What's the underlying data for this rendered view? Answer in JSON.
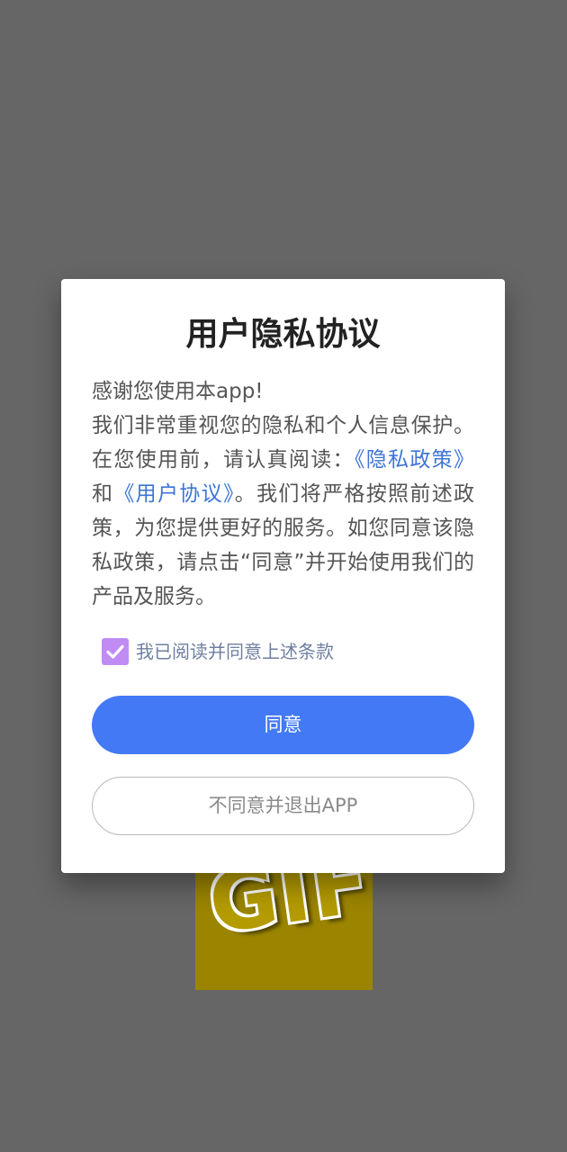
{
  "background_image": {
    "label": "GIF"
  },
  "dialog": {
    "title": "用户隐私协议",
    "greeting": "感谢您使用本app!",
    "body_intro": "我们非常重视您的隐私和个人信息保护。在您使用前，请认真阅读：",
    "privacy_link": "《隐私政策》",
    "conjunction": "和",
    "user_agreement_link": "《用户协议》",
    "body_rest": "。我们将严格按照前述政策，为您提供更好的服务。如您同意该隐私政策，请点击“同意”并开始使用我们的产品及服务。",
    "checkbox_checked": true,
    "checkbox_label": "我已阅读并同意上述条款",
    "agree_button": "同意",
    "exit_button": "不同意并退出APP"
  },
  "colors": {
    "overlay": "#666666",
    "primary": "#4379f5",
    "link": "#3e74d6",
    "checkbox": "#c08cf3"
  },
  "icons": {
    "checkbox": "checkmark-icon"
  }
}
